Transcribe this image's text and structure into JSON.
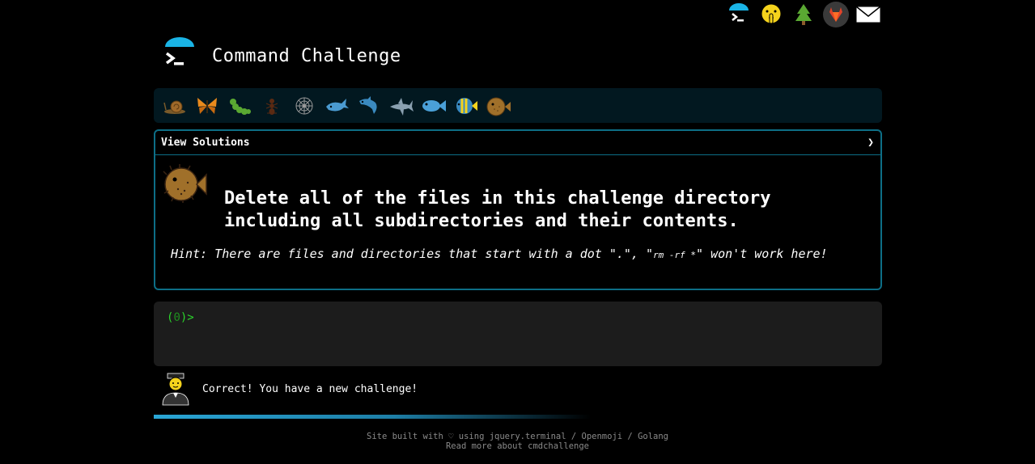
{
  "topbar": {
    "icons": [
      "terminal-logo-icon",
      "shushing-face-icon",
      "tree-icon",
      "gitlab-icon",
      "envelope-icon"
    ]
  },
  "header": {
    "title": "Command Challenge"
  },
  "creatures": [
    "snail-icon",
    "butterfly-icon",
    "caterpillar-icon",
    "ant-icon",
    "spider-web-icon",
    "whale-icon",
    "dolphin-icon",
    "shark-icon",
    "fish-icon",
    "tropical-fish-icon",
    "blowfish-icon"
  ],
  "solutions": {
    "label": "View Solutions",
    "chevron": "❯"
  },
  "challenge": {
    "line1": "Delete all of the files in this challenge directory",
    "line2": "including all subdirectories and their contents.",
    "hint_prefix": "Hint: There are files and directories that start with a dot \".\", \"",
    "hint_code": "rm -rf *",
    "hint_suffix": "\" won't work here!"
  },
  "terminal": {
    "prompt_open": "(",
    "prompt_count": "0",
    "prompt_close": ")>"
  },
  "message": {
    "text": "Correct! You have a new challenge!"
  },
  "progress": {
    "fraction": 0.42
  },
  "footer": {
    "line1_prefix": "Site built with ♡ using ",
    "link_jquery": "jquery.terminal",
    "sep1": " / ",
    "link_openmoji": "Openmoji",
    "sep2": " / ",
    "link_golang": "Golang",
    "line2_prefix": "Read more about ",
    "link_cmd": "cmdchallenge"
  },
  "colors": {
    "accent": "#0d6e86",
    "cyan": "#1ab4e6",
    "prompt": "#2bd42b"
  }
}
